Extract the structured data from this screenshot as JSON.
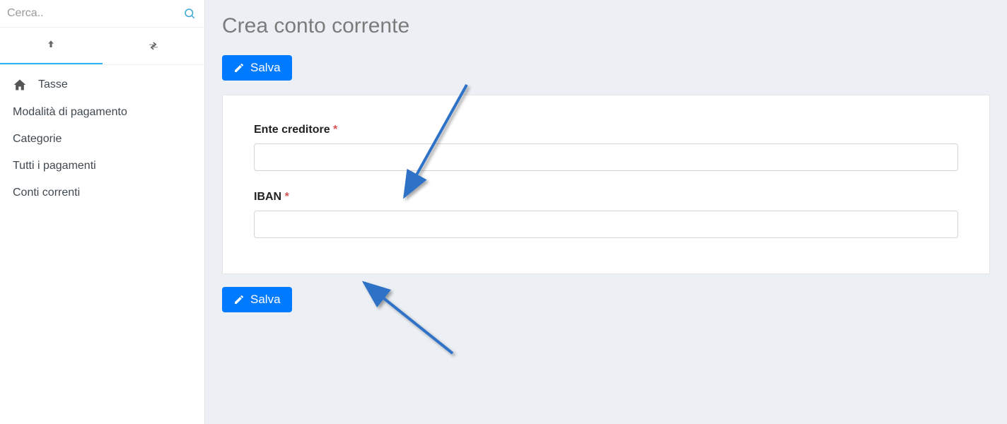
{
  "search": {
    "placeholder": "Cerca.."
  },
  "sidebar": {
    "items": [
      {
        "label": "Tasse"
      },
      {
        "label": "Modalità di pagamento"
      },
      {
        "label": "Categorie"
      },
      {
        "label": "Tutti i pagamenti"
      },
      {
        "label": "Conti correnti"
      }
    ]
  },
  "page": {
    "title": "Crea conto corrente"
  },
  "buttons": {
    "save": "Salva"
  },
  "form": {
    "ente_creditore": {
      "label": "Ente creditore",
      "value": ""
    },
    "iban": {
      "label": "IBAN",
      "value": ""
    }
  }
}
